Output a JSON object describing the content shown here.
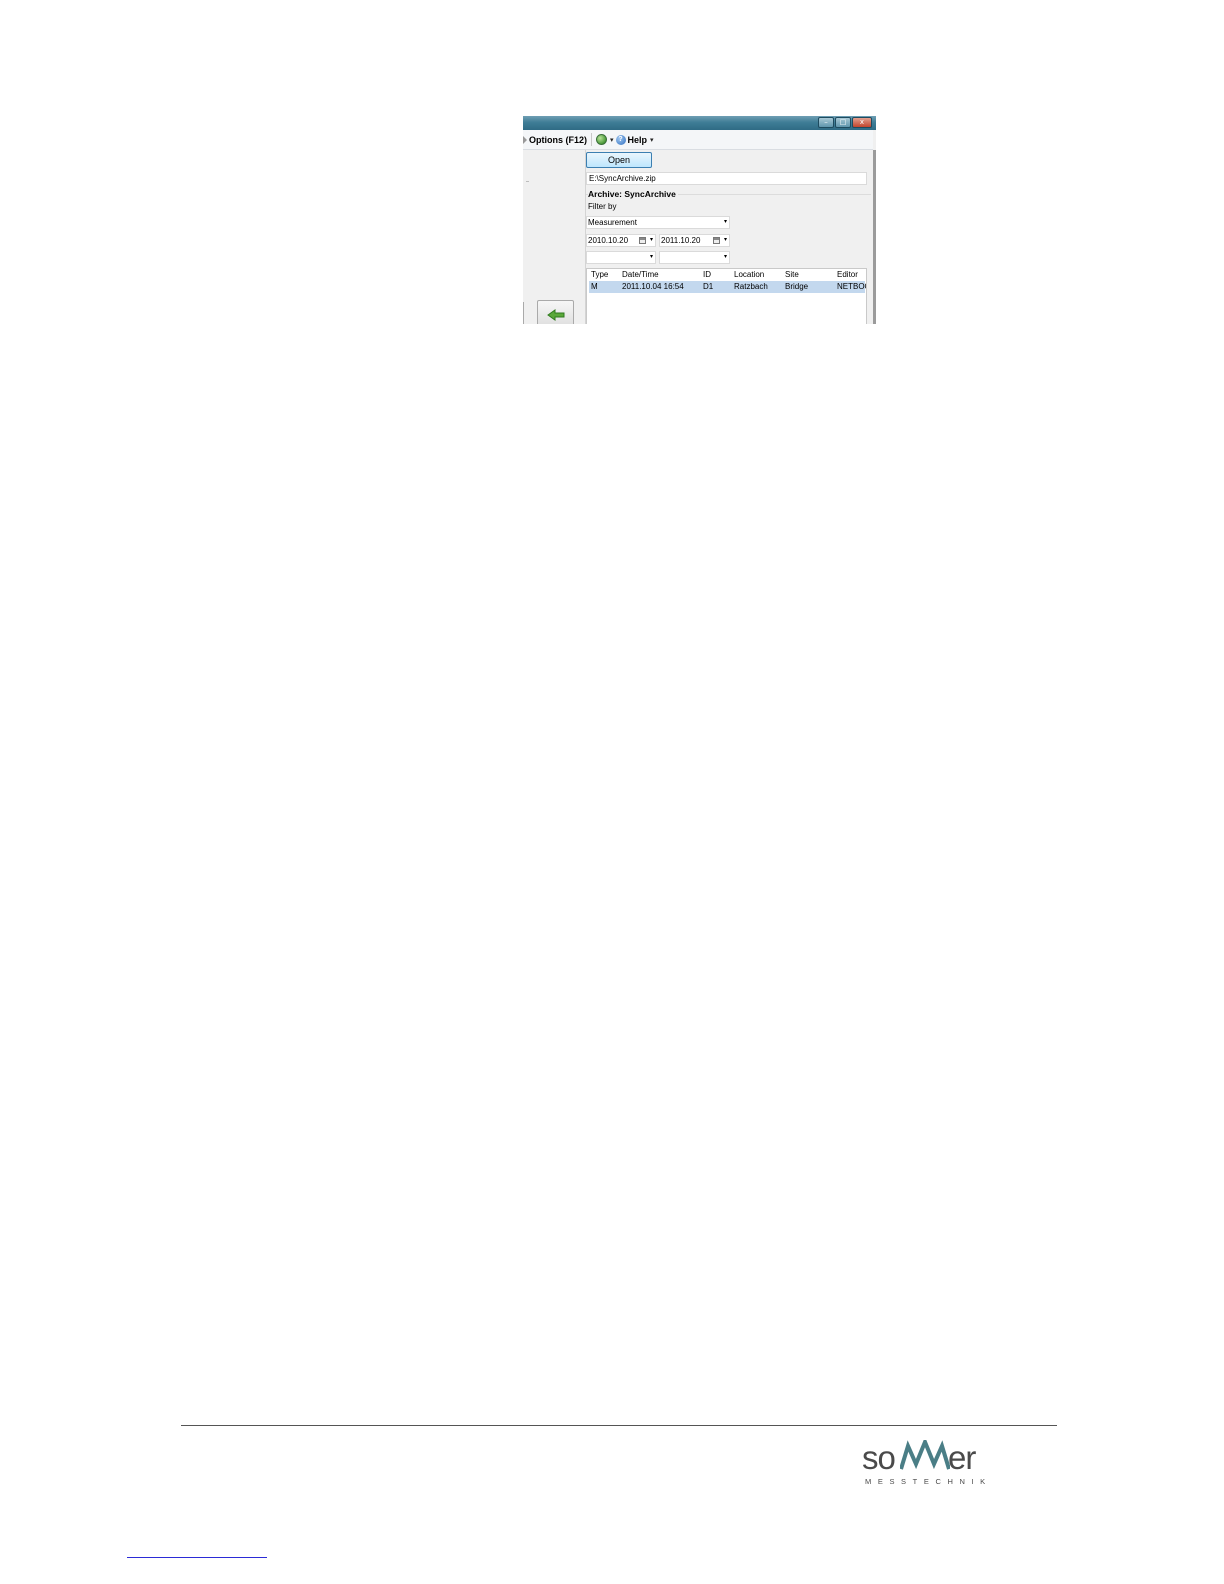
{
  "menu": {
    "options_label": "Options (F12)",
    "help_label": "Help",
    "dropdown_glyph": "▾"
  },
  "window_buttons": [
    "–",
    "□",
    "x"
  ],
  "toolbar": {
    "open_label": "Open"
  },
  "archive": {
    "path": "E:\\SyncArchive.zip",
    "group_title": "Archive: SyncArchive",
    "filter_label": "Filter by",
    "filter_value": "Measurement",
    "date_from": "2010.10.20",
    "date_to": "2011.10.20",
    "extra_filter_1": "",
    "extra_filter_2": ""
  },
  "table": {
    "columns": [
      "Type",
      "Date/Time",
      "ID",
      "Location",
      "Site",
      "Editor"
    ],
    "rows": [
      [
        "M",
        "2011.10.04 16:54",
        "D1",
        "Ratzbach",
        "Bridge",
        "NETBOOK"
      ]
    ]
  },
  "footer": {
    "logo_text_left": "so",
    "logo_text_right": "er",
    "logo_subtitle": "MESSTECHNIK"
  },
  "colors": {
    "titlebar": "#3f7d96",
    "selection": "#c3d8ee",
    "back_arrow": "#5aa83a",
    "logo_peaks": "#4a7e86",
    "link": "#2b2bd6"
  },
  "icons": {
    "back": "arrow-left-icon",
    "globe": "globe-icon",
    "help": "help-icon",
    "calendar": "calendar-icon"
  }
}
